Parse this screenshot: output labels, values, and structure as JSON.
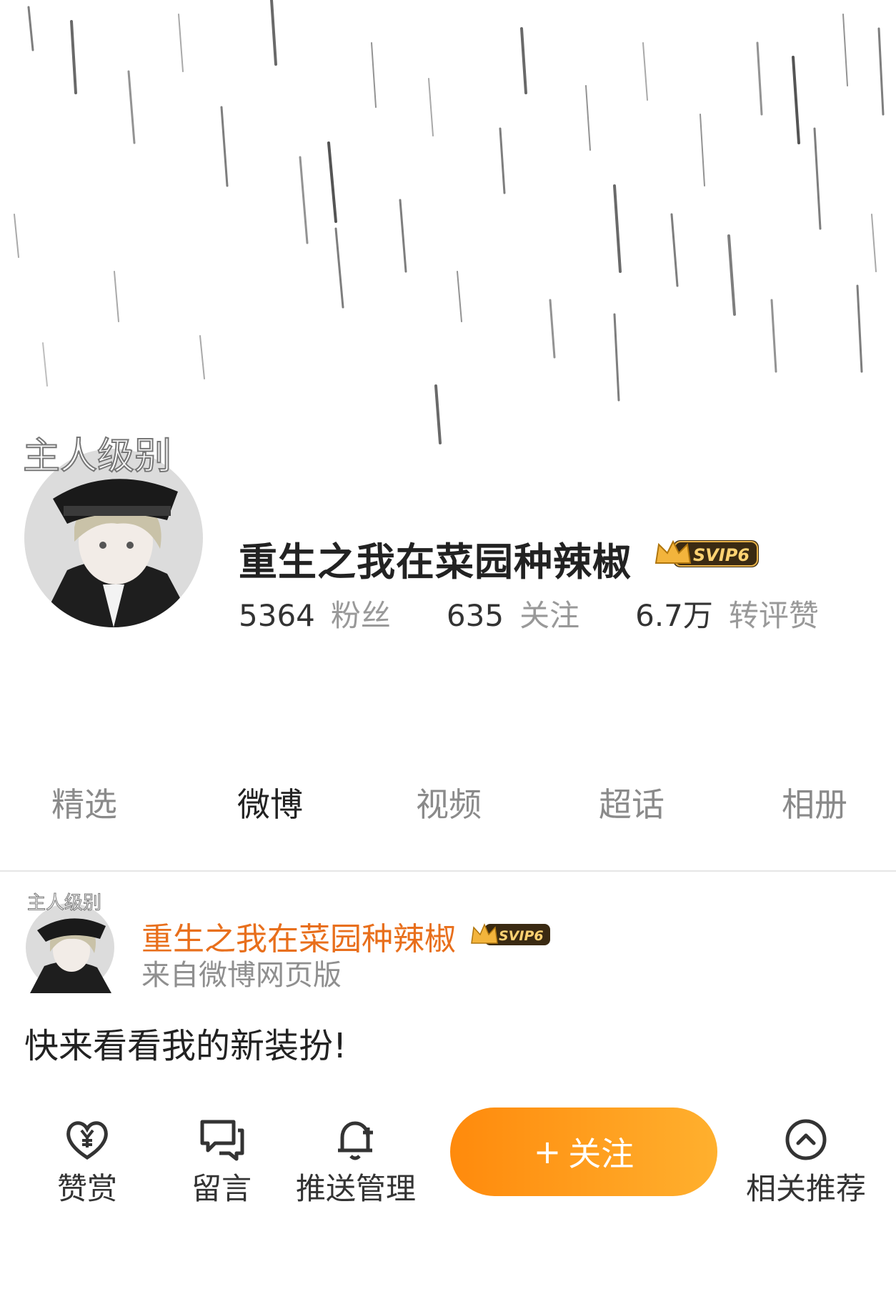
{
  "profile": {
    "name": "重生之我在菜园种辣椒",
    "vip_badge": "SVIP6",
    "avatar_overlay_text": "主人级别",
    "stats": [
      {
        "value": "5364",
        "label": "粉丝"
      },
      {
        "value": "635",
        "label": "关注"
      },
      {
        "value": "6.7万",
        "label": "转评赞"
      }
    ]
  },
  "tabs": [
    {
      "label": "精选",
      "active": false
    },
    {
      "label": "微博",
      "active": true
    },
    {
      "label": "视频",
      "active": false
    },
    {
      "label": "超话",
      "active": false
    },
    {
      "label": "相册",
      "active": false
    }
  ],
  "post": {
    "author": "重生之我在菜园种辣椒",
    "vip_badge": "SVIP6",
    "source": "来自微博网页版",
    "text": "快来看看我的新装扮!"
  },
  "bottom_bar": {
    "reward_label": "赞赏",
    "message_label": "留言",
    "push_label": "推送管理",
    "follow_label": "关注",
    "follow_plus": "+",
    "related_label": "相关推荐"
  },
  "colors": {
    "accent_orange": "#ff8a0c",
    "author_orange": "#e86f1c",
    "muted_gray": "#999999"
  }
}
